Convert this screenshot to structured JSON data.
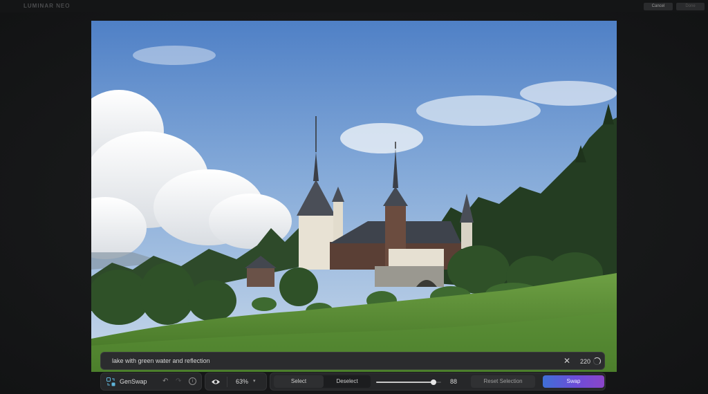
{
  "app": {
    "logo_main": "LUMINAR",
    "logo_sub": "NEO"
  },
  "window_buttons": {
    "cancel": "Cancel",
    "done": "Done"
  },
  "prompt": {
    "text": "lake with green water and reflection",
    "char_count": "220"
  },
  "toolbar": {
    "tool_name": "GenSwap",
    "zoom": "63%",
    "select_label": "Select",
    "deselect_label": "Deselect",
    "brush_size": "88",
    "brush_size_fraction": 0.88,
    "reset_label": "Reset Selection",
    "swap_label": "Swap"
  },
  "icons": {
    "genswap": "genswap-icon",
    "undo": "undo-icon",
    "redo": "redo-icon",
    "info": "info-icon",
    "visibility": "eye-icon",
    "clear": "close-icon",
    "loading": "spinner-icon"
  },
  "colors": {
    "swap_gradient_start": "#3f6fd6",
    "swap_gradient_end": "#8a45c8",
    "background": "#151617"
  }
}
